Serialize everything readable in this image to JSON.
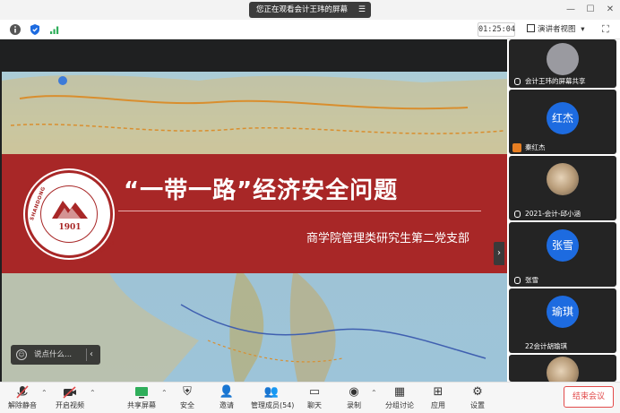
{
  "titlebar": {
    "share_status": "您正在观看会计王玮的屏幕",
    "menu_glyph": "☰",
    "minimize": "—",
    "maximize": "☐",
    "close": "✕"
  },
  "toolbar": {
    "timer": "01:25:04",
    "view_mode": "演讲者视图",
    "view_caret": "▾",
    "fullscreen": "⛶"
  },
  "slide": {
    "title": "“一带一路”经济安全问题",
    "subtitle": "商学院管理类研究生第二党支部",
    "logo_year": "1901",
    "logo_left_text": "SHANDONG",
    "logo_right_text": "UNIVERSITY"
  },
  "chat": {
    "placeholder": "说点什么...",
    "icon": "☺",
    "collapse": "‹"
  },
  "side_arrow": "›",
  "participants": [
    {
      "name": "会计王玮的屏幕共享",
      "avatar": "",
      "avatar_style": "gray"
    },
    {
      "name": "秦红杰",
      "avatar": "红杰",
      "avatar_style": "blue"
    },
    {
      "name": "2021-会计-邱小涵",
      "avatar": "",
      "avatar_style": "photo"
    },
    {
      "name": "张雪",
      "avatar": "张雪",
      "avatar_style": "blue"
    },
    {
      "name": "22会计胡瑜琪",
      "avatar": "瑜琪",
      "avatar_style": "blue"
    },
    {
      "name": "",
      "avatar": "",
      "avatar_style": "photo"
    }
  ],
  "bottom": {
    "unmute": "解除静音",
    "start_video": "开启视频",
    "share_screen": "共享屏幕",
    "security": "安全",
    "invite": "邀请",
    "manage_members": "管理成员(54)",
    "chat": "聊天",
    "record": "录制",
    "breakout": "分组讨论",
    "apps": "应用",
    "settings": "设置",
    "end_meeting": "结束会议"
  },
  "colors": {
    "banner": "#a82727",
    "avatar_blue": "#1d6be0",
    "end_red": "#e24a4a"
  }
}
